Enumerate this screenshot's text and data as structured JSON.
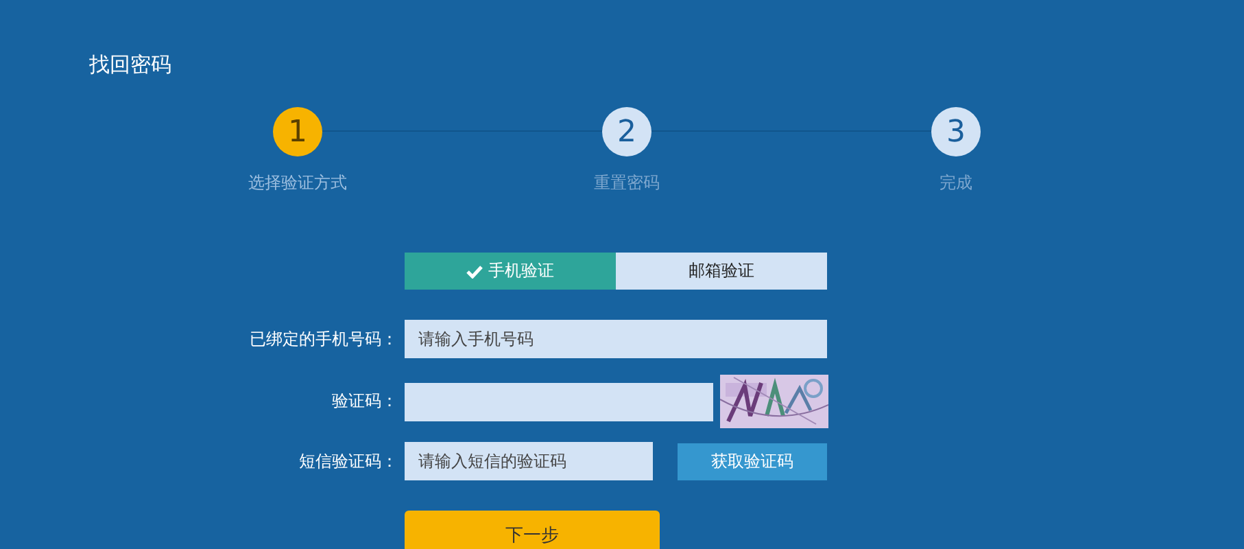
{
  "title": "找回密码",
  "steps": [
    {
      "number": "1",
      "label": "选择验证方式",
      "selected": true
    },
    {
      "number": "2",
      "label": "重置密码",
      "selected": false
    },
    {
      "number": "3",
      "label": "完成",
      "selected": false
    }
  ],
  "tabs": [
    {
      "label": "手机验证",
      "selected": true
    },
    {
      "label": "邮箱验证",
      "selected": false
    }
  ],
  "fields": [
    {
      "kind": "text",
      "label": "已绑定的手机号码：",
      "placeholder": "请输入手机号码"
    },
    {
      "kind": "captcha",
      "label": "验证码："
    },
    {
      "kind": "sms",
      "label": "短信验证码：",
      "placeholder": "请输入短信的验证码",
      "button": "获取验证码"
    }
  ],
  "next_button": "下一步"
}
